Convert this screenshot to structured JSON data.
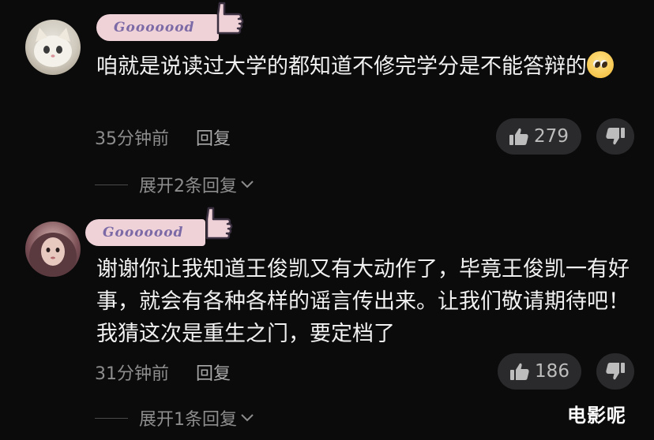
{
  "comments": [
    {
      "badge": "Gooooood",
      "text": "咱就是说读过大学的都知道不修完学分是不能答辩的",
      "time": "35分钟前",
      "reply": "回复",
      "likes": "279",
      "expand": "展开2条回复"
    },
    {
      "badge": "Gooooood",
      "text": "谢谢你让我知道王俊凯又有大动作了，毕竟王俊凯一有好事，就会有各种各样的谣言传出来。让我们敬请期待吧！我猜这次是重生之门，要定档了",
      "time": "31分钟前",
      "reply": "回复",
      "likes": "186",
      "expand": "展开1条回复"
    }
  ],
  "watermark": "电影呢",
  "colors": {
    "background": "#0b0b0c",
    "badge": "#efd1d8",
    "badge_text": "#7b6aa6",
    "pill": "#2a2a2c"
  },
  "icons": [
    "avatar-cat",
    "avatar-girl",
    "thumbs-up-sticker-icon",
    "pleading-face-emoji",
    "thumbs-up-icon",
    "thumbs-down-icon",
    "chevron-down-icon"
  ]
}
